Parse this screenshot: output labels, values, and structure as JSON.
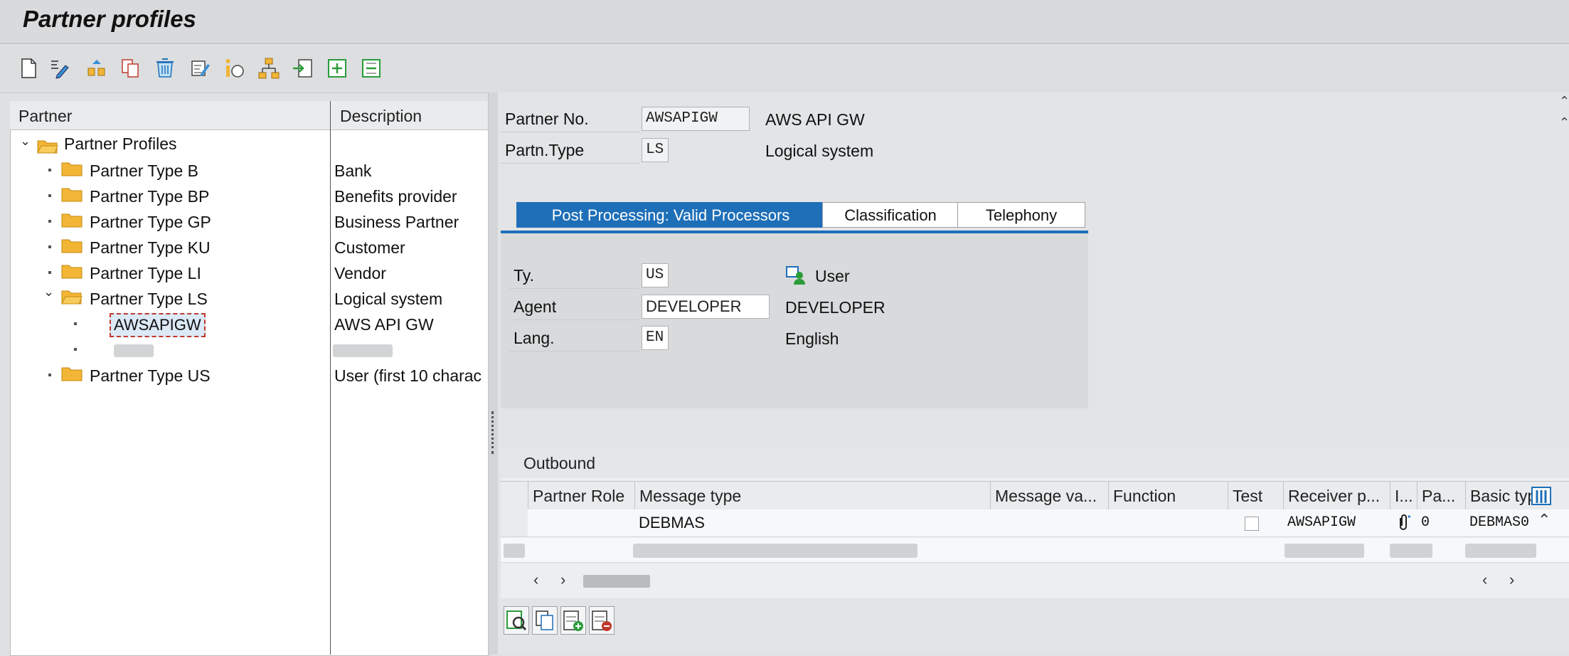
{
  "window": {
    "title": "Partner profiles"
  },
  "toolbar": {
    "buttons": [
      "new-document-icon",
      "display-change-icon",
      "other-partner-icon",
      "copy-icon",
      "delete-icon",
      "change-document-icon",
      "info-icon",
      "hierarchy-icon",
      "import-icon",
      "expand-icon",
      "collapse-icon"
    ]
  },
  "tree": {
    "headers": {
      "partner": "Partner",
      "description": "Description"
    },
    "root": "Partner Profiles",
    "nodes": [
      {
        "label": "Partner Type B",
        "desc": "Bank"
      },
      {
        "label": "Partner Type BP",
        "desc": "Benefits provider"
      },
      {
        "label": "Partner Type GP",
        "desc": "Business Partner"
      },
      {
        "label": "Partner Type KU",
        "desc": "Customer"
      },
      {
        "label": "Partner Type LI",
        "desc": "Vendor"
      },
      {
        "label": "Partner Type LS",
        "desc": "Logical system"
      },
      {
        "label": "AWSAPIGW",
        "desc": "AWS API GW"
      },
      {
        "label": "Partner Type US",
        "desc": "User (first 10 charac"
      }
    ]
  },
  "header": {
    "partner_no_label": "Partner No.",
    "partner_no_value": "AWSAPIGW",
    "partner_no_desc": "AWS API GW",
    "partn_type_label": "Partn.Type",
    "partn_type_value": "LS",
    "partn_type_desc": "Logical system"
  },
  "tabs": [
    "Post Processing: Valid Processors",
    "Classification",
    "Telephony"
  ],
  "post_processing": {
    "ty_label": "Ty.",
    "ty_value": "US",
    "ty_desc": "User",
    "agent_label": "Agent",
    "agent_value": "DEVELOPER",
    "agent_desc": "DEVELOPER",
    "lang_label": "Lang.",
    "lang_value": "EN",
    "lang_desc": "English"
  },
  "outbound": {
    "title": "Outbound",
    "columns": [
      "Partner Role",
      "Message type",
      "Message va...",
      "Function",
      "Test",
      "Receiver p...",
      "I...",
      "Pa...",
      "Basic typ"
    ],
    "rows": [
      {
        "partner_role": "",
        "message_type": "DEBMAS",
        "message_variant": "",
        "function": "",
        "test": false,
        "receiver_port": "AWSAPIGW",
        "pa": "0",
        "basic_type": "DEBMAS0"
      }
    ]
  },
  "colors": {
    "accent": "#1e6fb8",
    "folder": "#f2b535"
  }
}
